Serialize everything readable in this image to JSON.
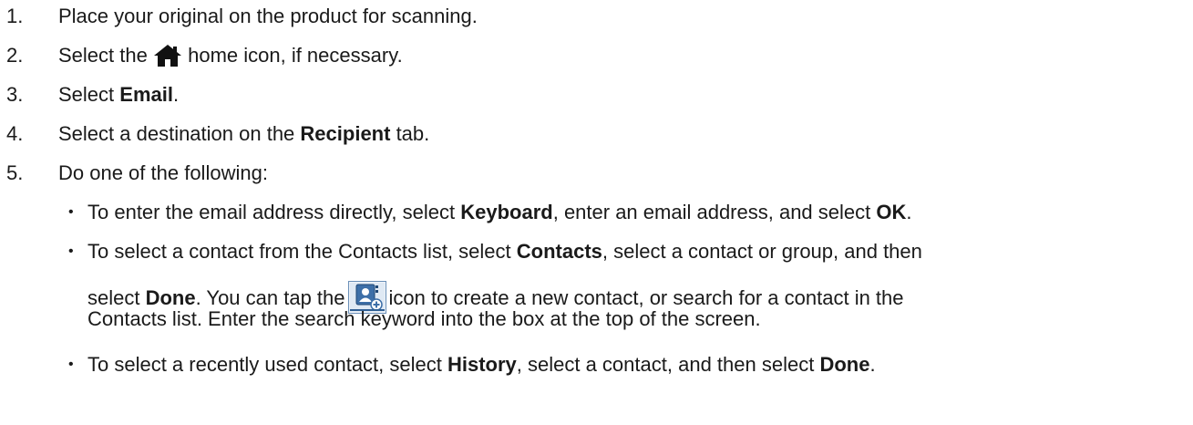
{
  "steps": [
    {
      "num": "1.",
      "text": "Place your original on the product for scanning."
    },
    {
      "num": "2.",
      "pre": "Select the",
      "post": "home icon, if necessary.",
      "icon": "home-icon"
    },
    {
      "num": "3.",
      "pre": "Select ",
      "bold": "Email",
      "post": "."
    },
    {
      "num": "4.",
      "pre": "Select a destination on the ",
      "bold": "Recipient",
      "post": " tab."
    },
    {
      "num": "5.",
      "text": "Do one of the following:"
    }
  ],
  "bullets": [
    {
      "t1": "To enter the email address directly, select ",
      "b1": "Keyboard",
      "t2": ", enter an email address, and select ",
      "b2": "OK",
      "t3": "."
    },
    {
      "line1_t1": "To select a contact from the Contacts list, select ",
      "line1_b1": "Contacts",
      "line1_t2": ", select a contact or group, and then",
      "line2_t1": "select ",
      "line2_b1": "Done",
      "line2_t2": ". You can tap the",
      "line2_t3": "icon to create a new contact, or search for a contact in the",
      "line3": "Contacts list. Enter the search keyword into the box at the top of the screen.",
      "icon": "add-contact-icon"
    },
    {
      "t1": "To select a recently used contact, select ",
      "b1": "History",
      "t2": ", select a contact, and then select ",
      "b2": "Done",
      "t3": "."
    }
  ]
}
